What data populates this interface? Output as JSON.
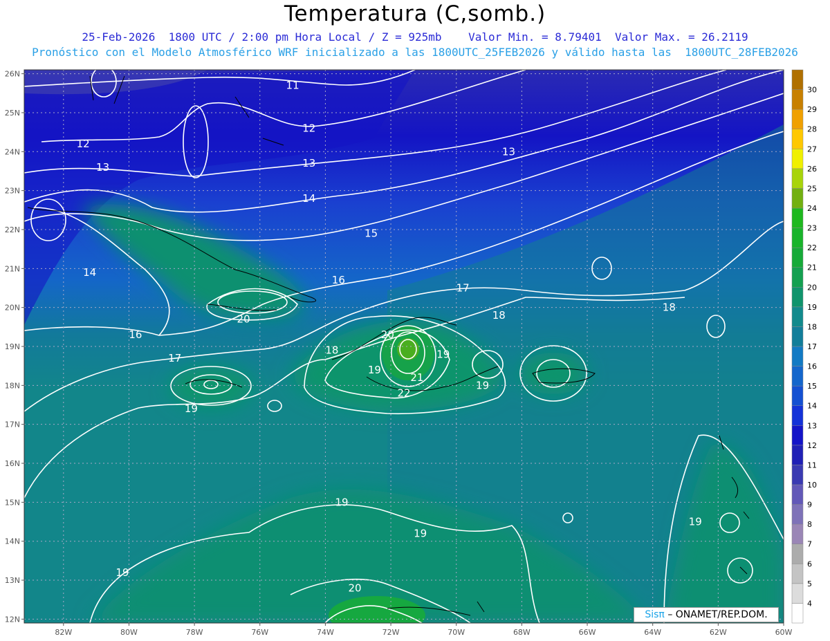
{
  "title": "Temperatura (C,somb.)",
  "subtitle_line1": "25-Feb-2026  1800 UTC / 2:00 pm Hora Local / Z = 925mb    Valor Min. = 8.79401  Valor Max. = 26.2119",
  "subtitle_line2": "Pronóstico con el Modelo Atmosférico WRF inicializado a las 1800UTC_25FEB2026 y válido hasta las  1800UTC_28FEB2026",
  "credit": {
    "logo": "Sisπ",
    "text": "– ONAMET/REP.DOM."
  },
  "map": {
    "lon_range": [
      -83.2,
      -60
    ],
    "lat_range": [
      11.9,
      26.1
    ],
    "lon_ticks": [
      "82W",
      "80W",
      "78W",
      "76W",
      "74W",
      "72W",
      "70W",
      "68W",
      "66W",
      "64W",
      "62W",
      "60W"
    ],
    "lon_tick_values": [
      -82,
      -80,
      -78,
      -76,
      -74,
      -72,
      -70,
      -68,
      -66,
      -64,
      -62,
      -60
    ],
    "lat_ticks": [
      "12N",
      "13N",
      "14N",
      "15N",
      "16N",
      "17N",
      "18N",
      "19N",
      "20N",
      "21N",
      "22N",
      "23N",
      "24N",
      "25N",
      "26N"
    ],
    "lat_tick_values": [
      12,
      13,
      14,
      15,
      16,
      17,
      18,
      19,
      20,
      21,
      22,
      23,
      24,
      25,
      26
    ],
    "contour_labels": [
      {
        "text": "11",
        "lon": -75.0,
        "lat": 25.7
      },
      {
        "text": "12",
        "lon": -74.5,
        "lat": 24.6
      },
      {
        "text": "12",
        "lon": -81.4,
        "lat": 24.2
      },
      {
        "text": "13",
        "lon": -68.4,
        "lat": 24.0
      },
      {
        "text": "13",
        "lon": -74.5,
        "lat": 23.7
      },
      {
        "text": "13",
        "lon": -80.8,
        "lat": 23.6
      },
      {
        "text": "14",
        "lon": -74.5,
        "lat": 22.8
      },
      {
        "text": "14",
        "lon": -81.2,
        "lat": 20.9
      },
      {
        "text": "15",
        "lon": -72.6,
        "lat": 21.9
      },
      {
        "text": "16",
        "lon": -73.6,
        "lat": 20.7
      },
      {
        "text": "16",
        "lon": -79.8,
        "lat": 19.3
      },
      {
        "text": "17",
        "lon": -69.8,
        "lat": 20.5
      },
      {
        "text": "17",
        "lon": -78.6,
        "lat": 18.7
      },
      {
        "text": "18",
        "lon": -68.7,
        "lat": 19.8
      },
      {
        "text": "18",
        "lon": -73.8,
        "lat": 18.9
      },
      {
        "text": "18",
        "lon": -63.5,
        "lat": 20.0
      },
      {
        "text": "19",
        "lon": -72.5,
        "lat": 18.4
      },
      {
        "text": "19",
        "lon": -70.4,
        "lat": 18.8
      },
      {
        "text": "19",
        "lon": -69.2,
        "lat": 18.0
      },
      {
        "text": "19",
        "lon": -78.1,
        "lat": 17.4
      },
      {
        "text": "19",
        "lon": -73.5,
        "lat": 15.0
      },
      {
        "text": "19",
        "lon": -71.1,
        "lat": 14.2
      },
      {
        "text": "19",
        "lon": -62.7,
        "lat": 14.5
      },
      {
        "text": "19",
        "lon": -80.2,
        "lat": 13.2
      },
      {
        "text": "20",
        "lon": -76.5,
        "lat": 19.7
      },
      {
        "text": "20",
        "lon": -72.1,
        "lat": 19.3
      },
      {
        "text": "20",
        "lon": -73.1,
        "lat": 12.8
      },
      {
        "text": "21",
        "lon": -71.2,
        "lat": 18.2
      },
      {
        "text": "22",
        "lon": -71.6,
        "lat": 17.8
      }
    ]
  },
  "colorbar": {
    "labels": [
      "4",
      "5",
      "6",
      "7",
      "8",
      "9",
      "10",
      "11",
      "12",
      "13",
      "14",
      "15",
      "16",
      "17",
      "18",
      "19",
      "20",
      "21",
      "22",
      "23",
      "24",
      "25",
      "26",
      "27",
      "28",
      "29",
      "30"
    ],
    "colors": [
      "#ffffff",
      "#dcdcdc",
      "#c4c4c4",
      "#acacac",
      "#9a86b6",
      "#7e72b8",
      "#6258b8",
      "#3a3ab2",
      "#2020b6",
      "#1414c8",
      "#1432d8",
      "#1450d2",
      "#1466cc",
      "#127ac4",
      "#127e9a",
      "#128a8c",
      "#10946c",
      "#14a050",
      "#16aa38",
      "#18b42a",
      "#1eb81e",
      "#72b010",
      "#a8d40a",
      "#f0f000",
      "#ffc800",
      "#f0a000",
      "#c88000",
      "#b07000"
    ]
  }
}
